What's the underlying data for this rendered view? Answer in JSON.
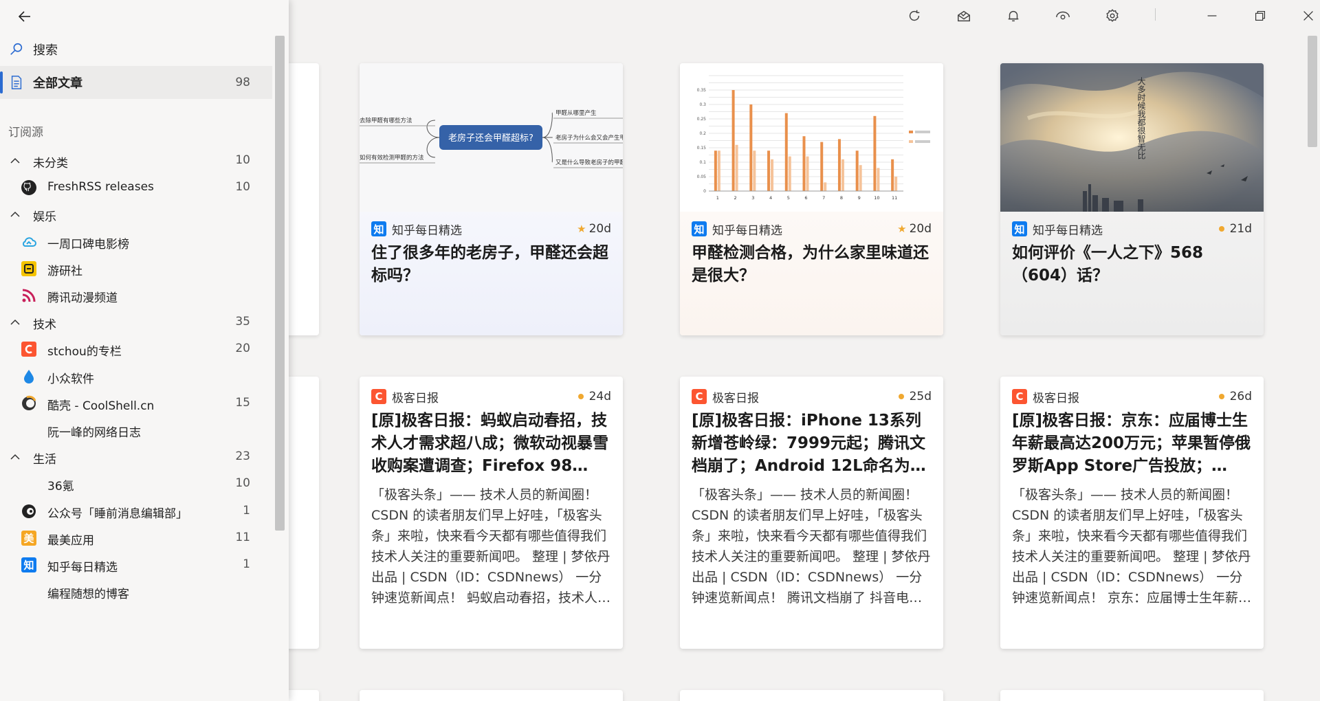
{
  "sidebar": {
    "search_label": "搜索",
    "all_articles": {
      "label": "全部文章",
      "count": "98"
    },
    "section_label": "订阅源",
    "groups": [
      {
        "label": "未分类",
        "count": "10",
        "feeds": [
          {
            "label": "FreshRSS releases",
            "count": "10",
            "icon": "github-icon"
          }
        ]
      },
      {
        "label": "娱乐",
        "count": "",
        "feeds": [
          {
            "label": "一周口碑电影榜",
            "count": "",
            "icon": "cloud-icon"
          },
          {
            "label": "游研社",
            "count": "",
            "icon": "yysls-icon"
          },
          {
            "label": "腾讯动漫频道",
            "count": "",
            "icon": "rss-icon"
          }
        ]
      },
      {
        "label": "技术",
        "count": "35",
        "feeds": [
          {
            "label": "stchou的专栏",
            "count": "20",
            "icon": "csdn-icon"
          },
          {
            "label": "小众软件",
            "count": "",
            "icon": "drop-icon"
          },
          {
            "label": "酷壳 - CoolShell.cn",
            "count": "15",
            "icon": "coolshell-icon"
          },
          {
            "label": "阮一峰的网络日志",
            "count": "",
            "icon": "none"
          }
        ]
      },
      {
        "label": "生活",
        "count": "23",
        "feeds": [
          {
            "label": "36氪",
            "count": "10",
            "icon": "none"
          },
          {
            "label": "公众号「睡前消息编辑部」",
            "count": "1",
            "icon": "eye-logo-icon"
          },
          {
            "label": "最美应用",
            "count": "11",
            "icon": "zuimei-icon"
          },
          {
            "label": "知乎每日精选",
            "count": "1",
            "icon": "zhihu-icon"
          },
          {
            "label": "编程随想的博客",
            "count": "",
            "icon": "none"
          }
        ]
      }
    ]
  },
  "cards": [
    {
      "source": "知乎每日精选",
      "source_icon": "知",
      "time": "20d",
      "starred": true,
      "title": "住了很多年的老房子，甲醛还会超标吗？",
      "thumb": "mindmap",
      "mindmap": {
        "center": "老房子还会甲醛超标?",
        "left": [
          "去除甲醛有哪些方法",
          "如何有效检测甲醛的方法"
        ],
        "right": [
          "甲醛从哪里产生",
          "老房子为什么会又会产生甲醛",
          "又是什么导致老房子的甲醛"
        ]
      }
    },
    {
      "source": "知乎每日精选",
      "source_icon": "知",
      "time": "20d",
      "starred": true,
      "title": "甲醛检测合格，为什么家里味道还是很大？",
      "thumb": "chart"
    },
    {
      "source": "知乎每日精选",
      "source_icon": "知",
      "time": "21d",
      "starred": false,
      "title": "如何评价《一人之下》568（604）话？",
      "thumb": "painting"
    },
    {
      "source": "极客日报",
      "source_icon": "C",
      "time": "24d",
      "starred": false,
      "title": "[原]极客日报：蚂蚁启动春招，技术人才需求超八成；微软动视暴雪收购案遭调查；Firefox 98…",
      "snippet": "「极客头条」—— 技术人员的新闻圈！ CSDN 的读者朋友们早上好哇，「极客头条」来啦，快来看今天都有哪些值得我们技术人关注的重要新闻吧。 整理 | 梦依丹 出品 | CSDN（ID：CSDNnews） 一分钟速览新闻点！ 蚂蚁启动春招，技术人才需求…"
    },
    {
      "source": "极客日报",
      "source_icon": "C",
      "time": "25d",
      "starred": false,
      "title": "[原]极客日报：iPhone 13系列新增苍岭绿：7999元起；腾讯文档崩了；Android 12L命名为…",
      "snippet": "「极客头条」—— 技术人员的新闻圈！ CSDN 的读者朋友们早上好哇，「极客头条」来啦，快来看今天都有哪些值得我们技术人关注的重要新闻吧。 整理 | 梦依丹 出品 | CSDN（ID：CSDNnews） 一分钟速览新闻点！ 腾讯文档崩了 抖音电商运营团…"
    },
    {
      "source": "极客日报",
      "source_icon": "C",
      "time": "26d",
      "starred": false,
      "title": "[原]极客日报：京东：应届博士生年薪最高达200万元；苹果暂停俄罗斯App Store广告投放；…",
      "snippet": "「极客头条」—— 技术人员的新闻圈！ CSDN 的读者朋友们早上好哇，「极客头条」来啦，快来看今天都有哪些值得我们技术人关注的重要新闻吧。 整理 | 梦依丹 出品 | CSDN（ID：CSDNnews） 一分钟速览新闻点！ 京东：应届博士生年薪最高达…"
    }
  ],
  "chart_data": {
    "type": "bar",
    "categories": [
      "1",
      "2",
      "3",
      "4",
      "5",
      "6",
      "7",
      "8",
      "9",
      "10",
      "11"
    ],
    "series": [
      {
        "name": "",
        "values": [
          0.14,
          0.35,
          0.3,
          0.14,
          0.27,
          0.19,
          0.17,
          0.18,
          0.14,
          0.26,
          0.11
        ]
      },
      {
        "name": "",
        "values": [
          0.14,
          0.16,
          0.14,
          0.11,
          0.12,
          0.12,
          0.03,
          0.11,
          0.09,
          0.08,
          0.05
        ]
      }
    ],
    "ylim": [
      0,
      0.4
    ],
    "yticks": [
      "0",
      "0.05",
      "0.1",
      "0.15",
      "0.2",
      "0.25",
      "0.3",
      "0.35"
    ],
    "colors": [
      "#e9904c",
      "#f5c39a"
    ]
  },
  "painting_text": "大多时候我都很智无比"
}
